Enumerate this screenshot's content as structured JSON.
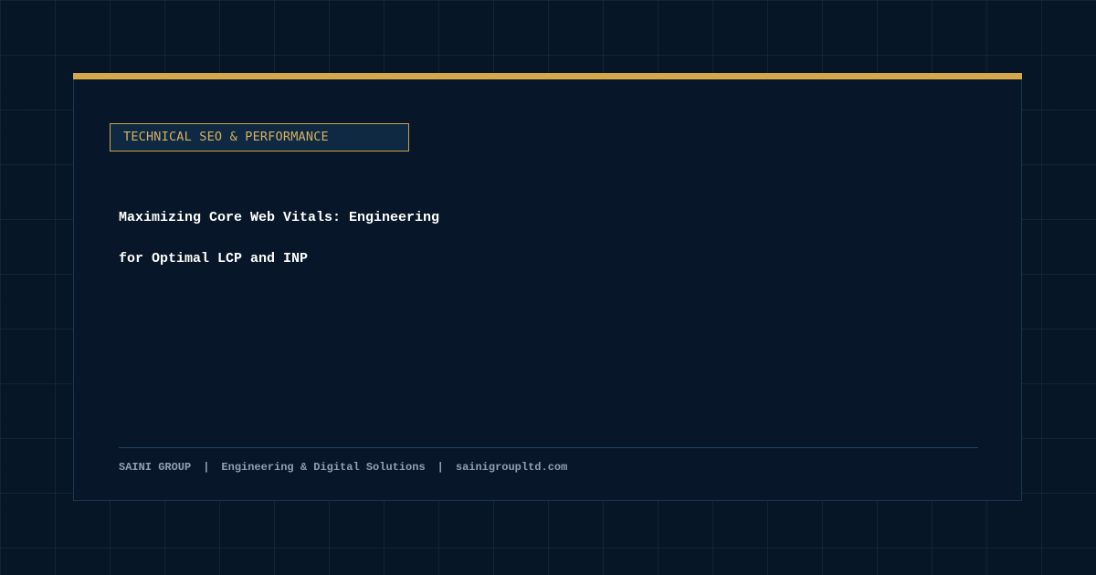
{
  "card": {
    "category_tag": "TECHNICAL SEO & PERFORMANCE",
    "title_lines": [
      "Maximizing Core Web Vitals: Engineering",
      "for Optimal LCP and INP"
    ]
  },
  "footer": {
    "company": "SAINI GROUP",
    "separator": "|",
    "tagline": "Engineering & Digital Solutions",
    "website": "sainigroupltd.com"
  },
  "colors": {
    "background": "#071627",
    "accent_gold": "#d4a84a",
    "tag_text": "#d4b062",
    "title_text": "#ffffff",
    "footer_text": "#8fa0b2"
  }
}
